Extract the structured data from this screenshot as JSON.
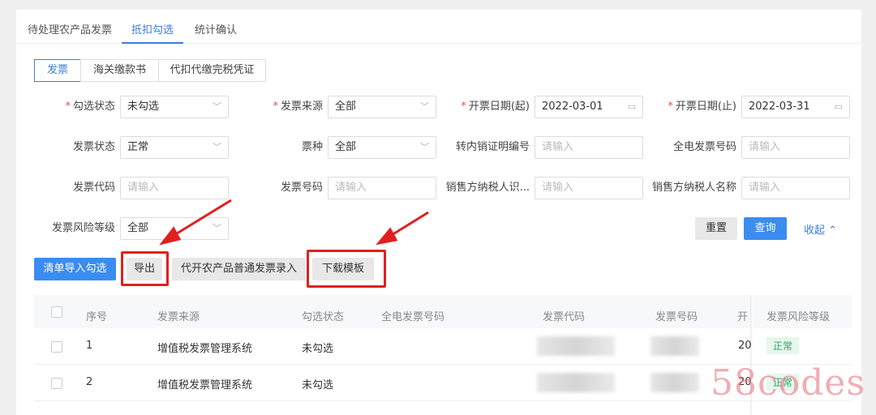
{
  "tabs": [
    "待处理农产品发票",
    "抵扣勾选",
    "统计确认"
  ],
  "segments": [
    "发票",
    "海关缴款书",
    "代扣代缴完税凭证"
  ],
  "form": [
    {
      "label": "勾选状态",
      "required": true,
      "value": "未勾选",
      "type": "select"
    },
    {
      "label": "发票来源",
      "required": true,
      "value": "全部",
      "type": "select"
    },
    {
      "label": "开票日期(起)",
      "required": true,
      "value": "2022-03-01",
      "type": "date"
    },
    {
      "label": "开票日期(止)",
      "required": true,
      "value": "2022-03-31",
      "type": "date"
    },
    {
      "label": "发票状态",
      "value": "正常",
      "type": "select"
    },
    {
      "label": "票种",
      "value": "全部",
      "type": "select"
    },
    {
      "label": "转内销证明编号",
      "placeholder": "请输入",
      "type": "input"
    },
    {
      "label": "全电发票号码",
      "placeholder": "请输入",
      "type": "input"
    },
    {
      "label": "发票代码",
      "placeholder": "请输入",
      "type": "input"
    },
    {
      "label": "发票号码",
      "placeholder": "请输入",
      "type": "input"
    },
    {
      "label": "销售方纳税人识...",
      "placeholder": "请输入",
      "type": "input"
    },
    {
      "label": "销售方纳税人名称",
      "placeholder": "请输入",
      "type": "input"
    },
    {
      "label": "发票风险等级",
      "value": "全部",
      "type": "select"
    }
  ],
  "actions": {
    "reset": "重置",
    "query": "查询",
    "collapse": "收起"
  },
  "toolbar": [
    "清单导入勾选",
    "导出",
    "代开农产品普通发票录入",
    "下载模板"
  ],
  "table": {
    "headers": [
      "序号",
      "发票来源",
      "勾选状态",
      "全电发票号码",
      "发票代码",
      "发票号码",
      "开",
      "发票风险等级"
    ],
    "rows": [
      {
        "no": "1",
        "source": "增值税发票管理系统",
        "status": "未勾选",
        "date": "20",
        "risk": "正常"
      },
      {
        "no": "2",
        "source": "增值税发票管理系统",
        "status": "未勾选",
        "date": "20",
        "risk": "正常"
      }
    ]
  },
  "watermark": "58codes"
}
